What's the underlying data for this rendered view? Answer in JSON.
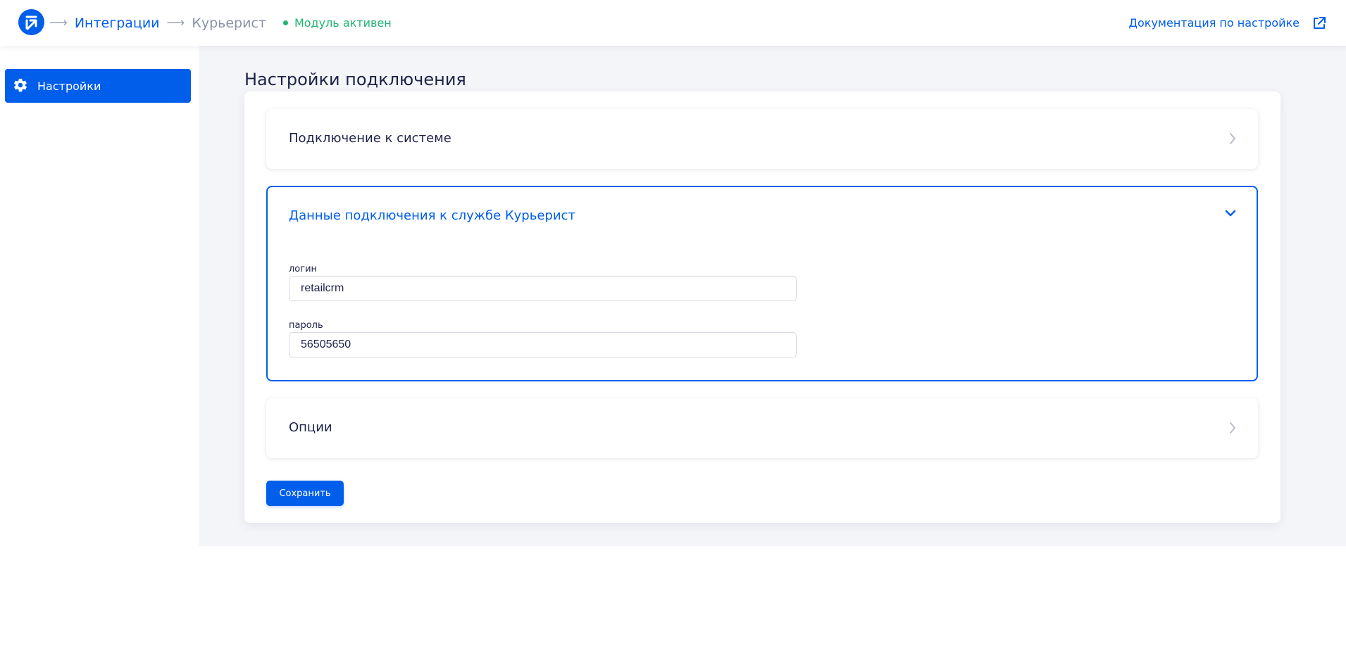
{
  "breadcrumbs": {
    "integrations": "Интеграции",
    "current": "Курьерист",
    "arrow": "⟶"
  },
  "status": {
    "text": "Модуль активен",
    "color": "#22b573"
  },
  "header": {
    "doc_link": "Документация по настройке"
  },
  "sidebar": {
    "items": [
      {
        "label": "Настройки",
        "icon": "gear-icon"
      }
    ]
  },
  "main": {
    "title": "Настройки подключения",
    "sections": [
      {
        "title": "Подключение к системе",
        "expanded": false
      },
      {
        "title": "Данные подключения к службе Курьерист",
        "expanded": true
      },
      {
        "title": "Опции",
        "expanded": false
      }
    ],
    "fields": {
      "login": {
        "label": "логин",
        "value": "retailcrm"
      },
      "password": {
        "label": "пароль",
        "value": "56505650"
      }
    },
    "save_label": "Сохранить"
  },
  "colors": {
    "accent": "#005eeb",
    "background": "#f4f5f8"
  }
}
